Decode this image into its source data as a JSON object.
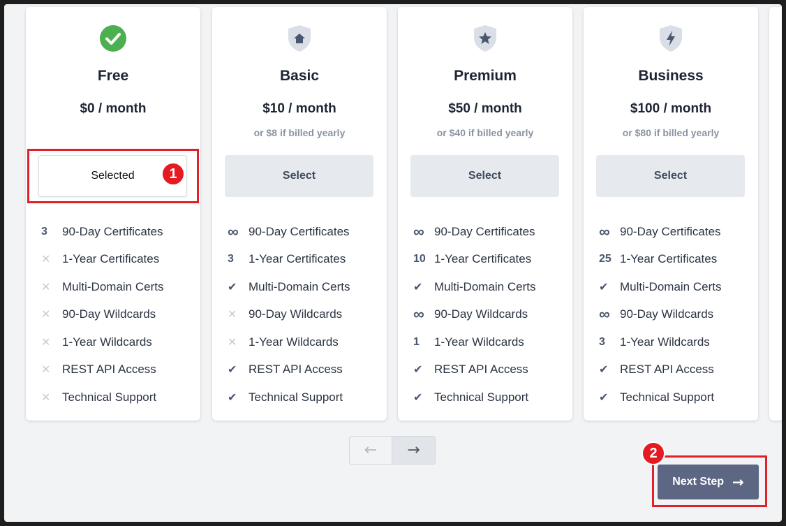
{
  "plans": [
    {
      "name": "Free",
      "price": "$0 / month",
      "yearly": "",
      "icon": "check-circle-icon",
      "button_label": "Selected",
      "selected": true,
      "features": [
        {
          "mark": "3",
          "type": "num",
          "label": "90-Day Certificates"
        },
        {
          "mark": "✕",
          "type": "cross",
          "label": "1-Year Certificates"
        },
        {
          "mark": "✕",
          "type": "cross",
          "label": "Multi-Domain Certs"
        },
        {
          "mark": "✕",
          "type": "cross",
          "label": "90-Day Wildcards"
        },
        {
          "mark": "✕",
          "type": "cross",
          "label": "1-Year Wildcards"
        },
        {
          "mark": "✕",
          "type": "cross",
          "label": "REST API Access"
        },
        {
          "mark": "✕",
          "type": "cross",
          "label": "Technical Support"
        }
      ]
    },
    {
      "name": "Basic",
      "price": "$10 / month",
      "yearly": "or $8 if billed yearly",
      "icon": "house-shield-icon",
      "button_label": "Select",
      "selected": false,
      "features": [
        {
          "mark": "∞",
          "type": "inf",
          "label": "90-Day Certificates"
        },
        {
          "mark": "3",
          "type": "num",
          "label": "1-Year Certificates"
        },
        {
          "mark": "✔",
          "type": "check",
          "label": "Multi-Domain Certs"
        },
        {
          "mark": "✕",
          "type": "cross",
          "label": "90-Day Wildcards"
        },
        {
          "mark": "✕",
          "type": "cross",
          "label": "1-Year Wildcards"
        },
        {
          "mark": "✔",
          "type": "check",
          "label": "REST API Access"
        },
        {
          "mark": "✔",
          "type": "check",
          "label": "Technical Support"
        }
      ]
    },
    {
      "name": "Premium",
      "price": "$50 / month",
      "yearly": "or $40 if billed yearly",
      "icon": "star-shield-icon",
      "button_label": "Select",
      "selected": false,
      "features": [
        {
          "mark": "∞",
          "type": "inf",
          "label": "90-Day Certificates"
        },
        {
          "mark": "10",
          "type": "num",
          "label": "1-Year Certificates"
        },
        {
          "mark": "✔",
          "type": "check",
          "label": "Multi-Domain Certs"
        },
        {
          "mark": "∞",
          "type": "inf",
          "label": "90-Day Wildcards"
        },
        {
          "mark": "1",
          "type": "num",
          "label": "1-Year Wildcards"
        },
        {
          "mark": "✔",
          "type": "check",
          "label": "REST API Access"
        },
        {
          "mark": "✔",
          "type": "check",
          "label": "Technical Support"
        }
      ]
    },
    {
      "name": "Business",
      "price": "$100 / month",
      "yearly": "or $80 if billed yearly",
      "icon": "bolt-shield-icon",
      "button_label": "Select",
      "selected": false,
      "features": [
        {
          "mark": "∞",
          "type": "inf",
          "label": "90-Day Certificates"
        },
        {
          "mark": "25",
          "type": "num",
          "label": "1-Year Certificates"
        },
        {
          "mark": "✔",
          "type": "check",
          "label": "Multi-Domain Certs"
        },
        {
          "mark": "∞",
          "type": "inf",
          "label": "90-Day Wildcards"
        },
        {
          "mark": "3",
          "type": "num",
          "label": "1-Year Wildcards"
        },
        {
          "mark": "✔",
          "type": "check",
          "label": "REST API Access"
        },
        {
          "mark": "✔",
          "type": "check",
          "label": "Technical Support"
        }
      ]
    }
  ],
  "pager": {
    "prev": "←",
    "next": "→"
  },
  "next_step": {
    "label": "Next Step",
    "arrow": "→"
  },
  "annotations": [
    {
      "label": "1"
    },
    {
      "label": "2"
    }
  ],
  "colors": {
    "accent": "#5d6683",
    "check_green": "#4caf50",
    "shield_bg": "#d9dee7",
    "shield_fg": "#4a5670",
    "annotation_red": "#e0202a"
  }
}
